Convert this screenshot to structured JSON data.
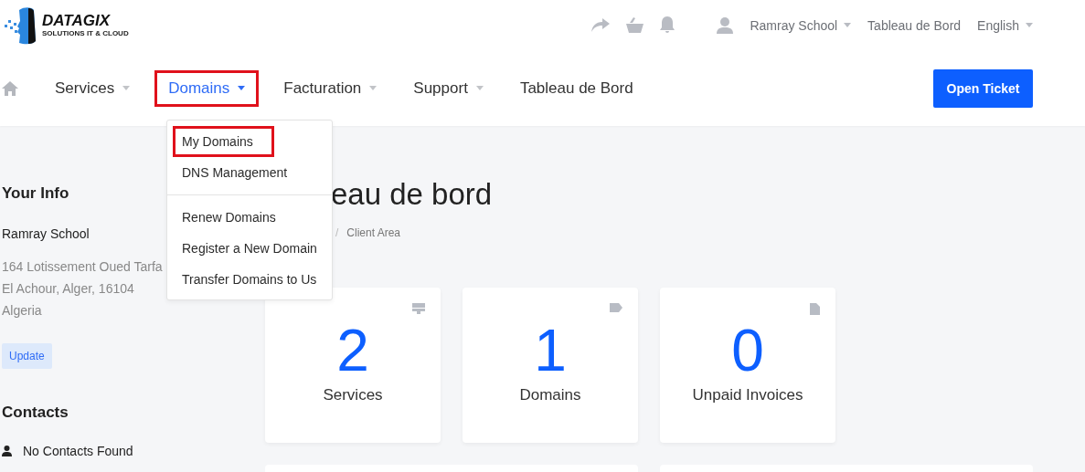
{
  "logo": {
    "name": "DATAGIX",
    "tagline": "SOLUTIONS IT & CLOUD"
  },
  "top_bar": {
    "account": "Ramray School",
    "dashboard_link": "Tableau de Bord",
    "language": "English"
  },
  "nav": {
    "items": [
      {
        "label": "Services",
        "dropdown": true,
        "selected": false,
        "highlighted": false
      },
      {
        "label": "Domains",
        "dropdown": true,
        "selected": true,
        "highlighted": true
      },
      {
        "label": "Facturation",
        "dropdown": true,
        "selected": false,
        "highlighted": false
      },
      {
        "label": "Support",
        "dropdown": true,
        "selected": false,
        "highlighted": false
      },
      {
        "label": "Tableau de Bord",
        "dropdown": false,
        "selected": false,
        "highlighted": false
      }
    ],
    "button": "Open Ticket"
  },
  "dropdown_menu": {
    "groups": [
      [
        {
          "label": "My Domains",
          "highlighted": true
        },
        {
          "label": "DNS Management",
          "highlighted": false
        }
      ],
      [
        {
          "label": "Renew Domains",
          "highlighted": false
        },
        {
          "label": "Register a New Domain",
          "highlighted": false
        },
        {
          "label": "Transfer Domains to Us",
          "highlighted": false
        }
      ]
    ]
  },
  "sidebar": {
    "info_title": "Your Info",
    "name": "Ramray School",
    "address": [
      "164 Lotissement Oued Tarfa",
      "El Achour, Alger, 16104",
      "Algeria"
    ],
    "update_button": "Update",
    "contacts_title": "Contacts",
    "contacts_empty": "No Contacts Found"
  },
  "page": {
    "title": "eau de bord",
    "breadcrumb": {
      "separator": "/",
      "current": "Client Area"
    }
  },
  "stats": [
    {
      "kind": "server",
      "value": "2",
      "label": "Services"
    },
    {
      "kind": "tag",
      "value": "1",
      "label": "Domains"
    },
    {
      "kind": "document",
      "value": "0",
      "label": "Unpaid Invoices"
    }
  ]
}
